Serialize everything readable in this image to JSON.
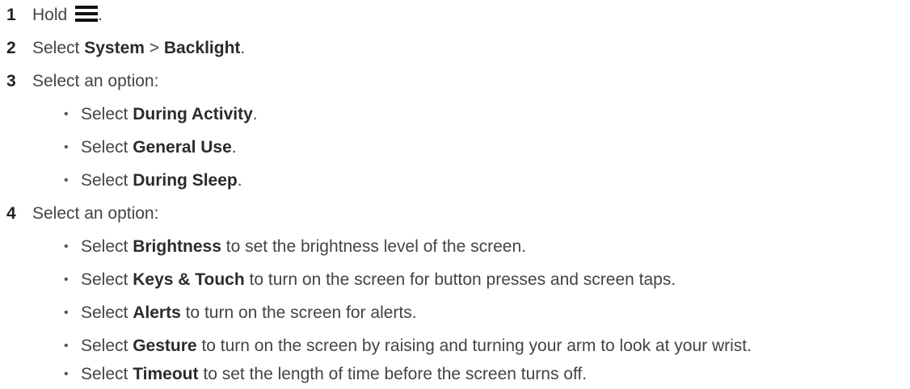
{
  "steps": [
    {
      "number": "1",
      "prefix": "Hold",
      "icon": "menu-icon",
      "suffix": "."
    },
    {
      "number": "2",
      "prefix": "Select",
      "bold1": "System",
      "sep": " > ",
      "bold2": "Backlight",
      "suffix": "."
    },
    {
      "number": "3",
      "text": "Select an option:",
      "options": [
        {
          "prefix": "Select",
          "bold": "During Activity",
          "suffix": "."
        },
        {
          "prefix": "Select",
          "bold": "General Use",
          "suffix": "."
        },
        {
          "prefix": "Select",
          "bold": "During Sleep",
          "suffix": "."
        }
      ]
    },
    {
      "number": "4",
      "text": "Select an option:",
      "options": [
        {
          "prefix": "Select",
          "bold": "Brightness",
          "suffix": "to set the brightness level of the screen."
        },
        {
          "prefix": "Select",
          "bold": "Keys & Touch",
          "suffix": "to turn on the screen for button presses and screen taps."
        },
        {
          "prefix": "Select",
          "bold": "Alerts",
          "suffix": "to turn on the screen for alerts."
        },
        {
          "prefix": "Select",
          "bold": "Gesture",
          "suffix": "to turn on the screen by raising and turning your arm to look at your wrist."
        },
        {
          "prefix": "Select",
          "bold": "Timeout",
          "suffix": "to set the length of time before the screen turns off."
        }
      ]
    }
  ],
  "bullet_char": "•"
}
